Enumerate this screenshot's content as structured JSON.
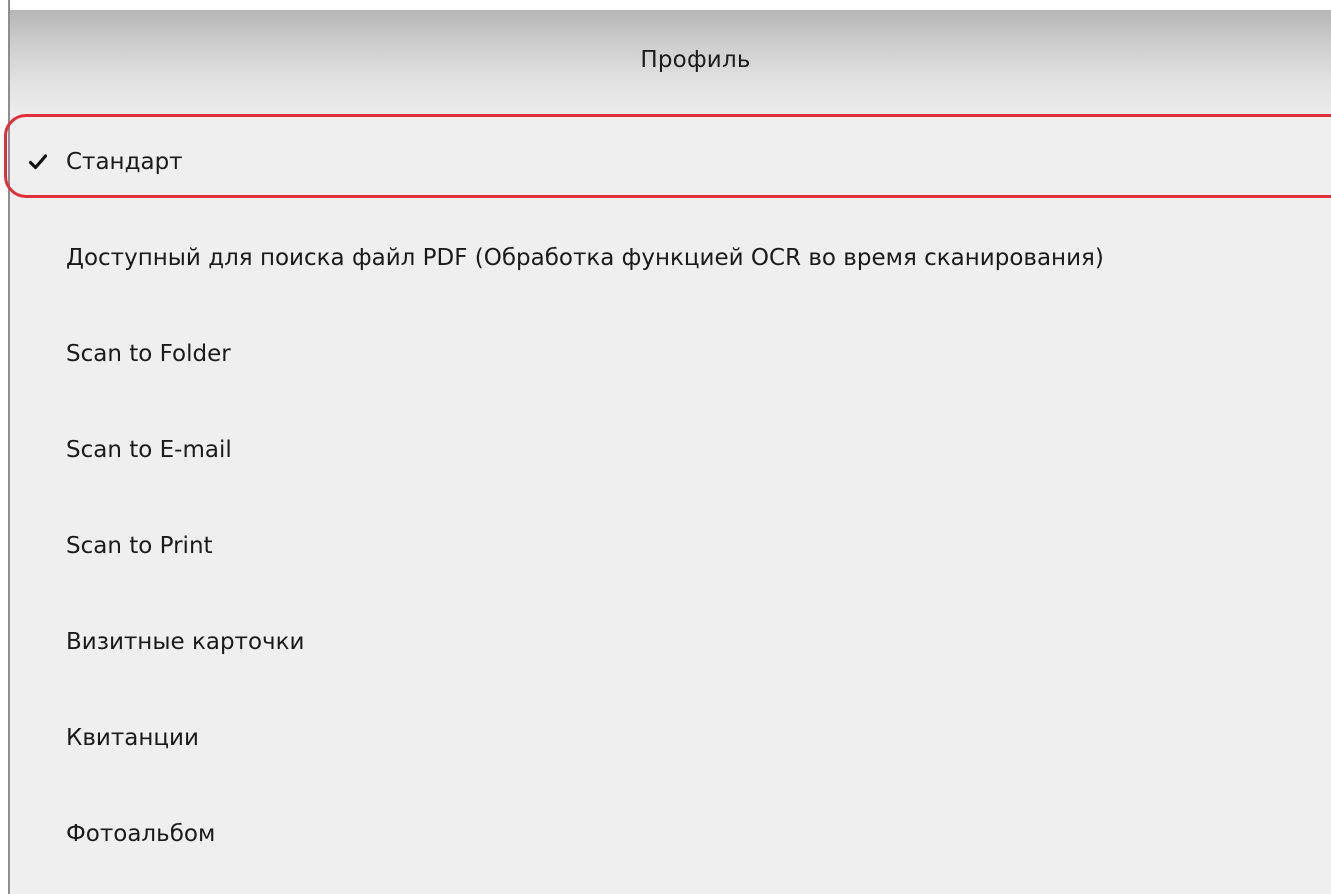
{
  "menu": {
    "header": "Профиль",
    "items": [
      {
        "label": "Стандарт",
        "checked": true
      },
      {
        "label": "Доступный для поиска файл PDF (Обработка функцией OCR во время сканирования)",
        "checked": false
      },
      {
        "label": "Scan to Folder",
        "checked": false
      },
      {
        "label": "Scan to E-mail",
        "checked": false
      },
      {
        "label": "Scan to Print",
        "checked": false
      },
      {
        "label": "Визитные карточки",
        "checked": false
      },
      {
        "label": "Квитанции",
        "checked": false
      },
      {
        "label": "Фотоальбом",
        "checked": false
      }
    ]
  },
  "icons": {
    "check": "checkmark-icon"
  },
  "colors": {
    "highlight": "#e0313a",
    "menu_background": "#efefef",
    "text": "#1a1a1a"
  }
}
